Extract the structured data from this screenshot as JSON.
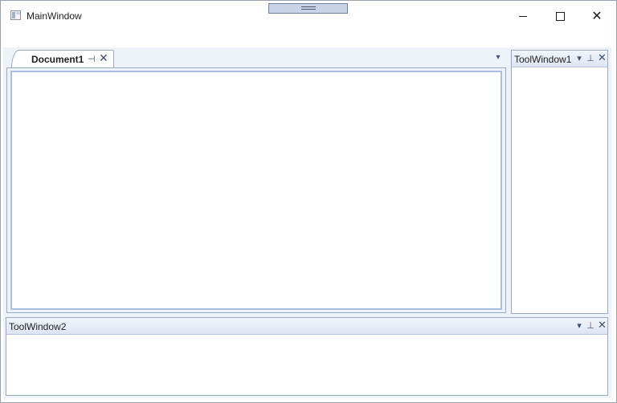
{
  "window": {
    "title": "MainWindow",
    "controls": {
      "minimize_icon": "minimize-icon",
      "maximize_icon": "maximize-icon",
      "close_glyph": "✕"
    }
  },
  "document": {
    "tab_label": "Document1",
    "pin_glyph": "⊣",
    "close_glyph": "✕",
    "menu_glyph": "▾"
  },
  "tool_windows": [
    {
      "title": "ToolWindow1",
      "menu_glyph": "▾",
      "pin_glyph": "⊥",
      "close_glyph": "✕"
    },
    {
      "title": "ToolWindow2",
      "menu_glyph": "▾",
      "pin_glyph": "⊥",
      "close_glyph": "✕"
    }
  ],
  "colors": {
    "accent_border": "#a9bfe0",
    "header_gradient_top": "#f2f5fb",
    "header_gradient_bottom": "#dde5f3",
    "dock_background": "#eef2f9"
  }
}
